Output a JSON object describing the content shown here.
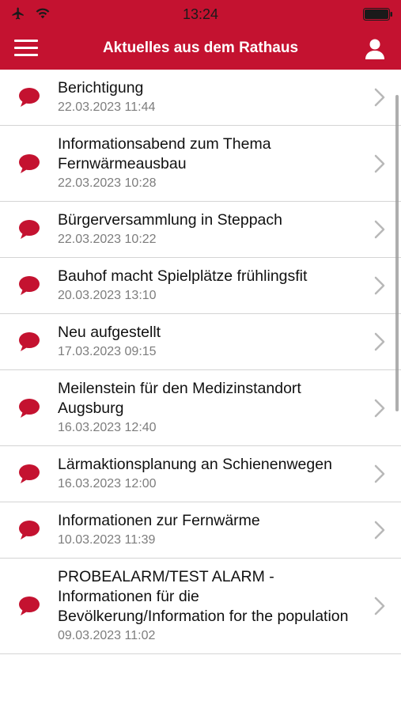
{
  "status": {
    "time": "13:24"
  },
  "header": {
    "title": "Aktuelles aus dem Rathaus"
  },
  "items": [
    {
      "title": "Berichtigung",
      "date": "22.03.2023 11:44"
    },
    {
      "title": "Informationsabend zum Thema Fernwärmeausbau",
      "date": "22.03.2023 10:28"
    },
    {
      "title": "Bürgerversammlung in Steppach",
      "date": "22.03.2023 10:22"
    },
    {
      "title": "Bauhof macht Spielplätze frühlingsfit",
      "date": "20.03.2023 13:10"
    },
    {
      "title": "Neu aufgestellt",
      "date": "17.03.2023 09:15"
    },
    {
      "title": "Meilenstein für den Medizinstandort Augsburg",
      "date": "16.03.2023 12:40"
    },
    {
      "title": "Lärmaktionsplanung an Schienenwegen",
      "date": "16.03.2023 12:00"
    },
    {
      "title": "Informationen zur Fernwärme",
      "date": "10.03.2023 11:39"
    },
    {
      "title": "PROBEALARM/TEST ALARM - Informationen für die Bevölkerung/Information for the population",
      "date": "09.03.2023 11:02"
    }
  ],
  "icons": {
    "menu": "hamburger-menu-icon",
    "profile": "user-icon",
    "item": "speech-bubble-icon",
    "disclosure": "chevron-right-icon"
  },
  "colors": {
    "brand": "#c41230",
    "bubble": "#c41230",
    "date_text": "#7d7d7d"
  }
}
